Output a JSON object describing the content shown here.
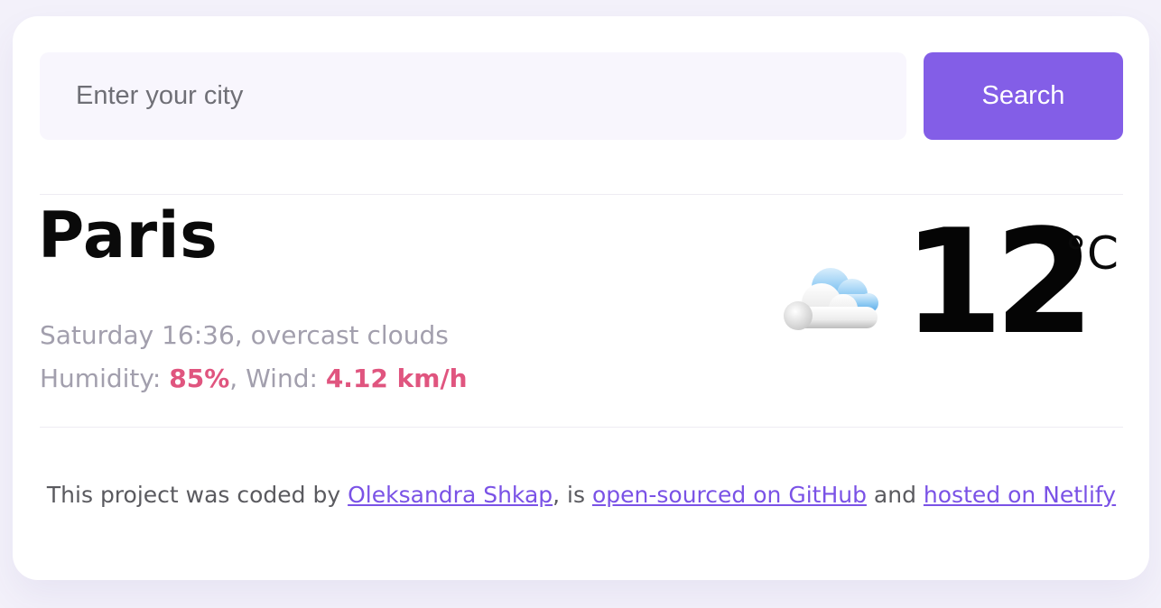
{
  "search": {
    "placeholder": "Enter your city",
    "value": "",
    "button_label": "Search"
  },
  "weather": {
    "city": "Paris",
    "datetime": "Saturday 16:36",
    "description": "overcast clouds",
    "humidity_label": "Humidity:",
    "humidity_value": "85%",
    "wind_label": "Wind:",
    "wind_value": "4.12 km/h",
    "temperature": "12",
    "unit": "°C",
    "icon": "cloud-icon"
  },
  "footer": {
    "text_1": "This project was coded by",
    "author_link": "Oleksandra Shkap",
    "text_2": ", is",
    "github_link": "open-sourced on GitHub",
    "text_3": "and",
    "netlify_link": "hosted on Netlify"
  },
  "colors": {
    "accent": "#835ee7",
    "highlight": "#e0557f",
    "muted_text": "#a29fad",
    "background": "#f3f1fa"
  }
}
